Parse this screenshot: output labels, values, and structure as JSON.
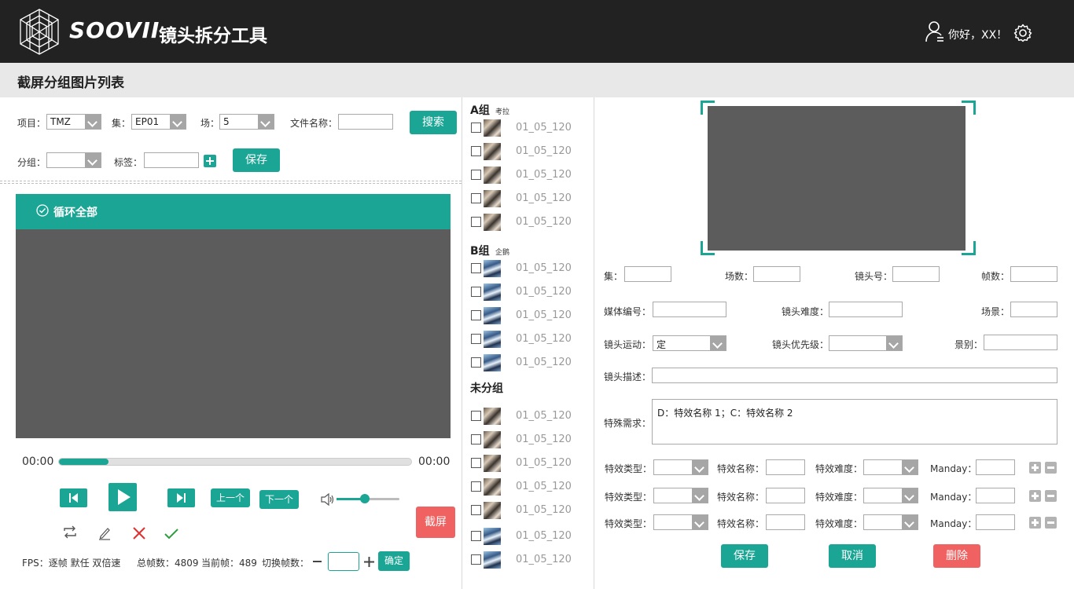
{
  "header": {
    "brand": "SOOVII",
    "app_name": "镜头拆分工具",
    "greeting": "你好，XX！"
  },
  "page_title": "截屏分组图片列表",
  "filters": {
    "project_label": "项目：",
    "project_value": "TMZ",
    "episode_label": "集：",
    "episode_value": "EP01",
    "scene_label": "场：",
    "scene_value": "5",
    "filename_label": "文件名称：",
    "filename_value": "",
    "search_button": "搜索",
    "group_label": "分组：",
    "group_value": "",
    "tag_label": "标签：",
    "tag_value": "",
    "save_button": "保存"
  },
  "player": {
    "loop_label": "循环全部",
    "time_start": "00:00",
    "time_end": "00:00",
    "progress": 0.14,
    "volume": 0.45,
    "prev_button": "上一个",
    "next_button": "下一个",
    "capture_button": "截屏",
    "fps_info": "FPS：逐帧  默任  双倍速",
    "total_frames": "总帧数：4809",
    "current_frame": "当前帧：489",
    "switch_frames_label": "切换帧数：",
    "switch_frames_value": "",
    "confirm_button": "确定"
  },
  "thumb_list": {
    "groups": [
      {
        "title": "A组",
        "note": "考拉",
        "items": [
          "01_05_120",
          "01_05_120",
          "01_05_120",
          "01_05_120",
          "01_05_120"
        ]
      },
      {
        "title": "B组",
        "note": "企鹅",
        "items": [
          "01_05_120",
          "01_05_120",
          "01_05_120",
          "01_05_120",
          "01_05_120"
        ]
      },
      {
        "title": "未分组",
        "note": "",
        "items": [
          "01_05_120",
          "01_05_120",
          "01_05_120",
          "01_05_120",
          "01_05_120",
          "01_05_120",
          "01_05_120"
        ]
      }
    ]
  },
  "detail": {
    "episode_label": "集：",
    "scene_count_label": "场数：",
    "shot_no_label": "镜头号：",
    "frame_count_label": "帧数：",
    "media_no_label": "媒体编号：",
    "shot_difficulty_label": "镜头难度：",
    "scenery_label": "场景：",
    "camera_motion_label": "镜头运动：",
    "camera_motion_value": "定",
    "shot_priority_label": "镜头优先级：",
    "shot_size_label": "景别：",
    "shot_desc_label": "镜头描述：",
    "special_req_label": "特殊需求：",
    "special_req_value": "D：特效名称 1；C：特效名称 2",
    "fx_type_label": "特效类型：",
    "fx_name_label": "特效名称：",
    "fx_difficulty_label": "特效难度：",
    "manday_label": "Manday：",
    "save_button": "保存",
    "cancel_button": "取消",
    "delete_button": "删除"
  },
  "colors": {
    "accent": "#1aa595",
    "danger": "#f06161",
    "header_bg": "#222222",
    "video_bg": "#5c5c5c"
  }
}
